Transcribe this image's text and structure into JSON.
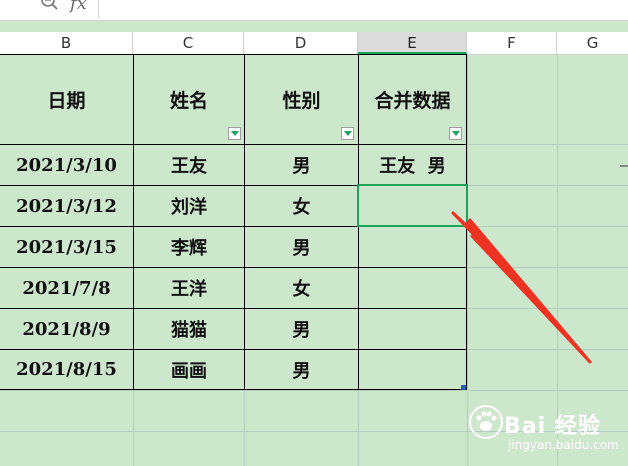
{
  "formula_bar": {
    "zoom_icon": "zoom-icon",
    "fx_label": "fx"
  },
  "columns": [
    "B",
    "C",
    "D",
    "E",
    "F",
    "G"
  ],
  "selected_column": "E",
  "table": {
    "headers": [
      "日期",
      "姓名",
      "性别",
      "合并数据"
    ],
    "rows": [
      [
        "2021/3/10",
        "王友",
        "男",
        "王友  男"
      ],
      [
        "2021/3/12",
        "刘洋",
        "女",
        ""
      ],
      [
        "2021/3/15",
        "李辉",
        "男",
        ""
      ],
      [
        "2021/7/8",
        "王洋",
        "女",
        ""
      ],
      [
        "2021/8/9",
        "猫猫",
        "男",
        ""
      ],
      [
        "2021/8/15",
        "画画",
        "男",
        ""
      ]
    ]
  },
  "annotation": {
    "arrow_color": "#ee3322"
  },
  "watermark": {
    "text": "Bai 经验",
    "sub": "jingyan.baidu.com"
  },
  "colors": {
    "background": "#cde7cd",
    "selection": "#1aa35b",
    "header_bg": "#ffffff"
  }
}
